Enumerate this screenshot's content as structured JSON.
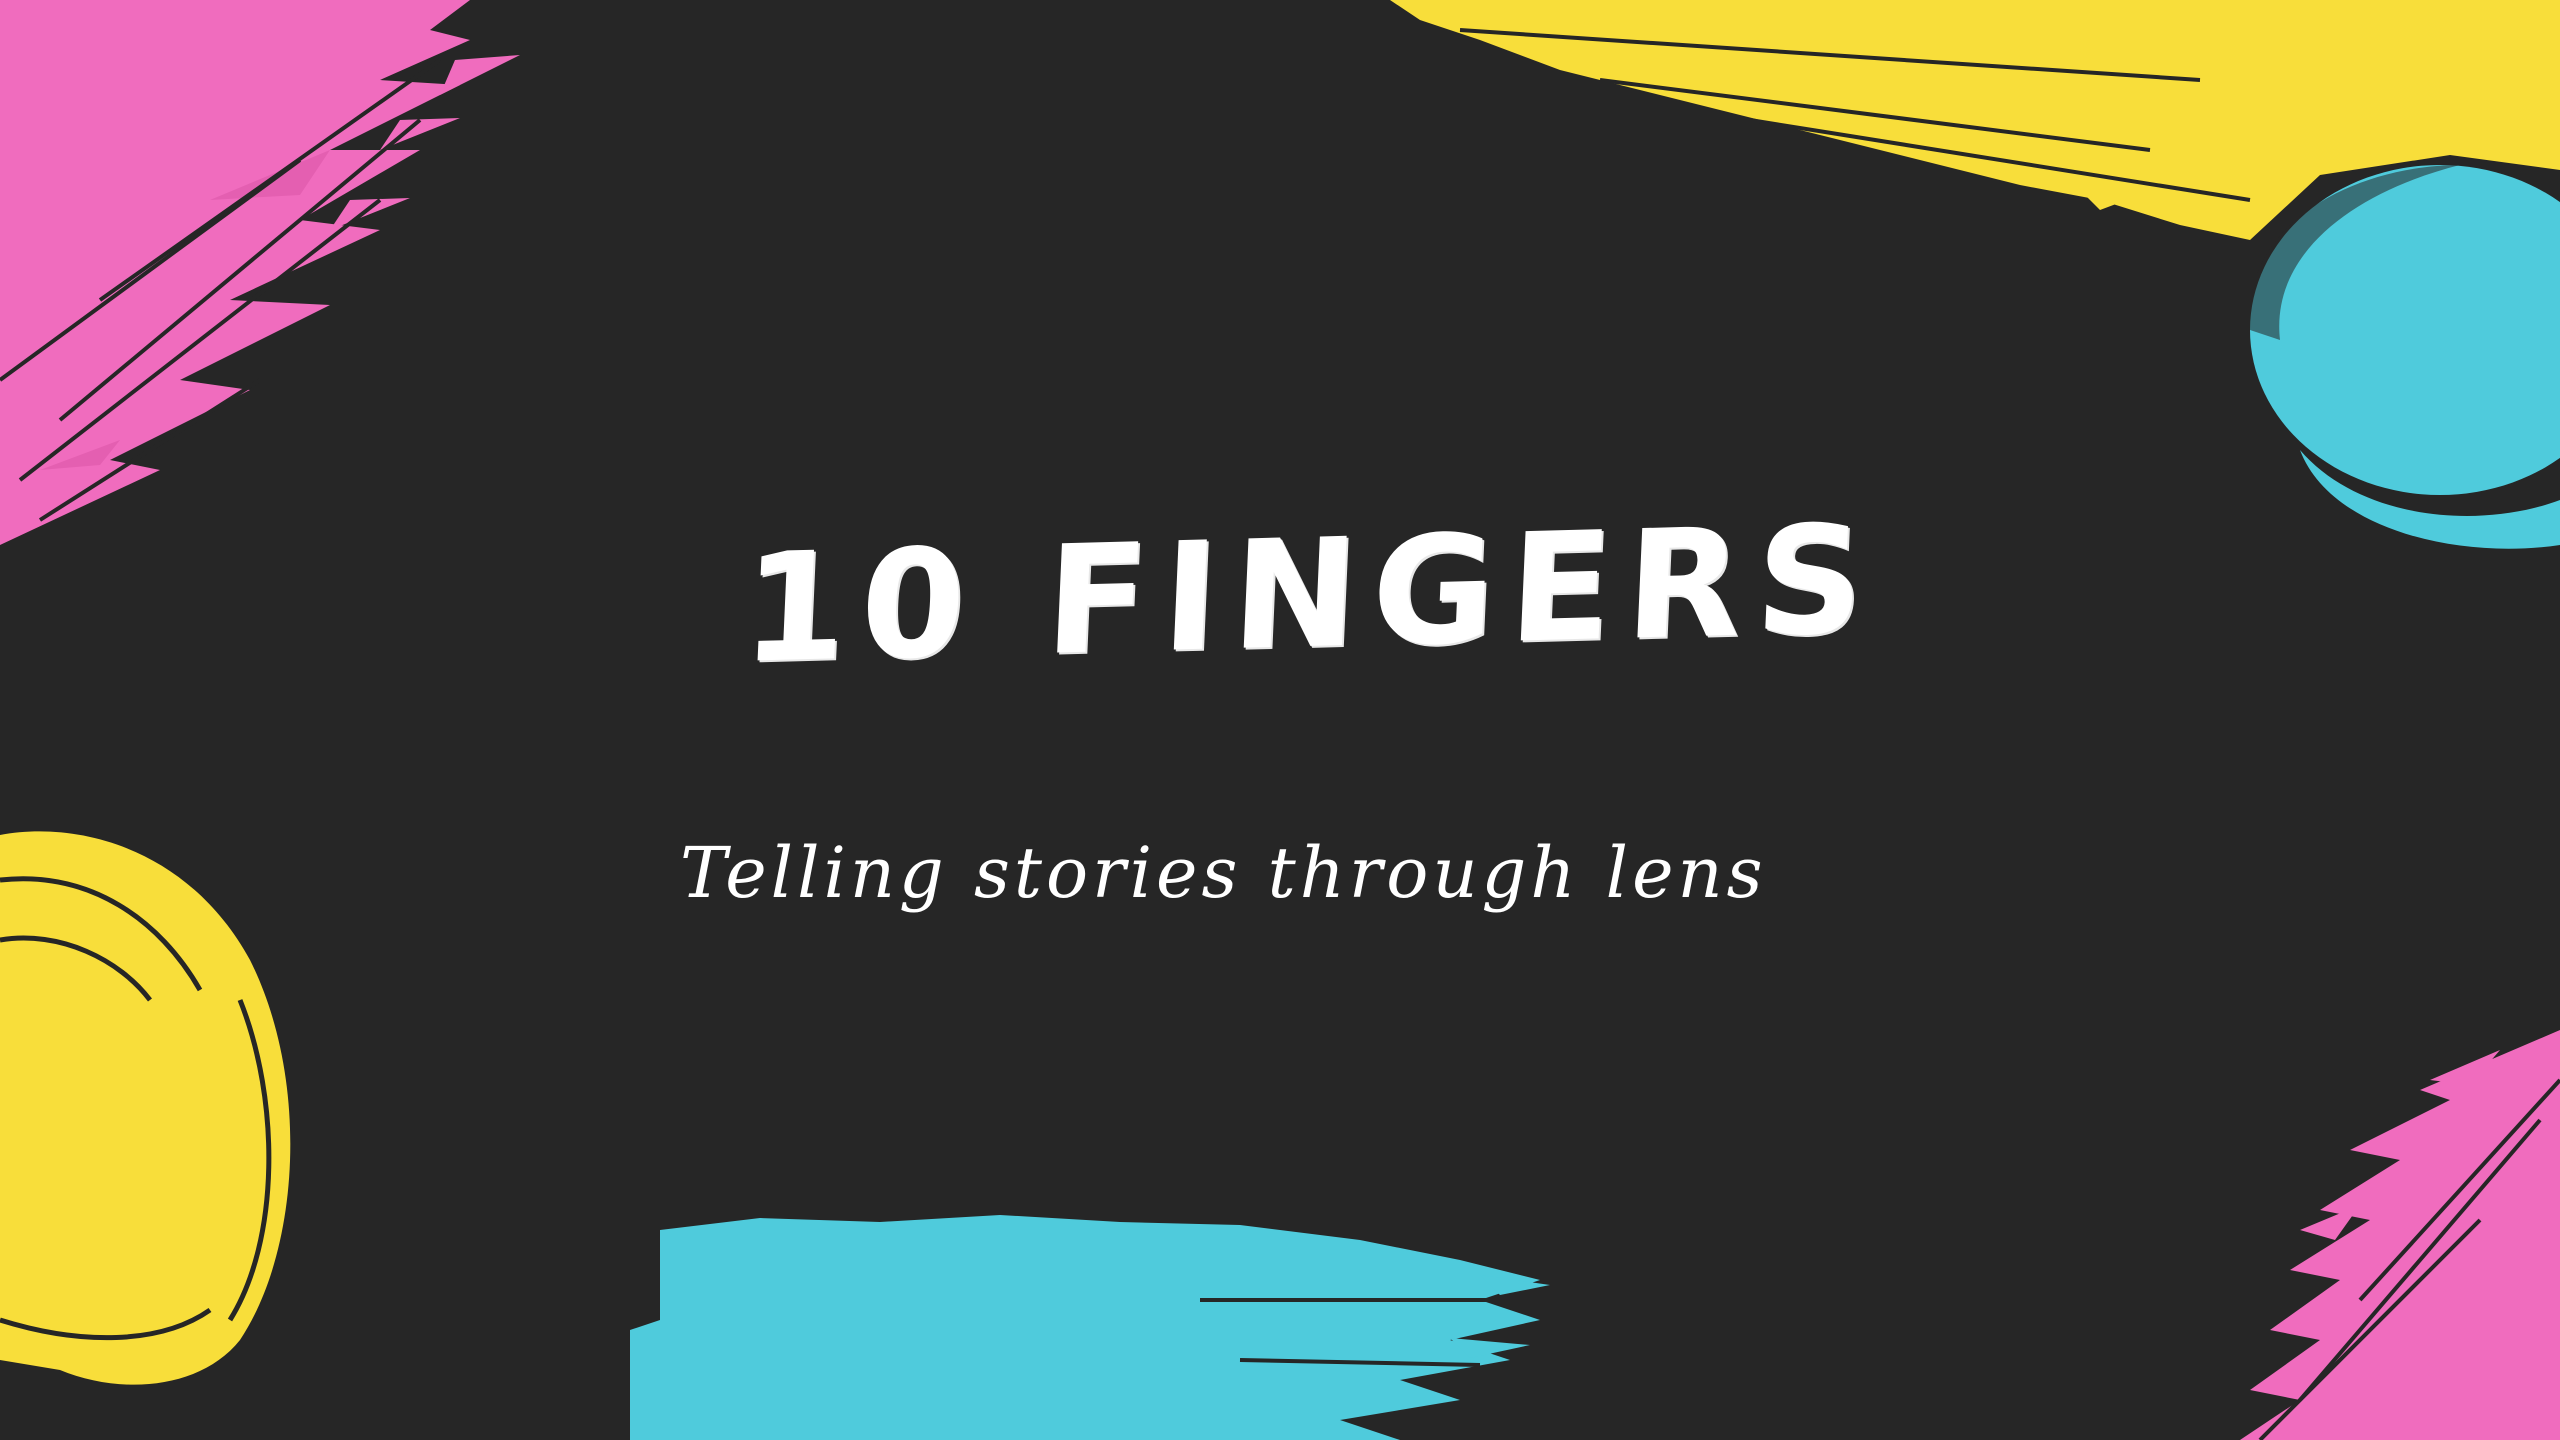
{
  "slide": {
    "title": "10 FINGERS",
    "subtitle": "Telling stories through lens"
  },
  "colors": {
    "background": "#262626",
    "pink": "#f06cbe",
    "yellow": "#f8de3a",
    "cyan": "#4fcbdc",
    "text": "#ffffff"
  },
  "decorations": [
    {
      "name": "pink-brush-stroke-top-left",
      "color": "pink"
    },
    {
      "name": "yellow-brush-stroke-top-right",
      "color": "yellow"
    },
    {
      "name": "cyan-brush-blob-right",
      "color": "cyan"
    },
    {
      "name": "yellow-brush-blob-left",
      "color": "yellow"
    },
    {
      "name": "cyan-brush-stroke-bottom",
      "color": "cyan"
    },
    {
      "name": "pink-brush-stroke-bottom-right",
      "color": "pink"
    }
  ]
}
